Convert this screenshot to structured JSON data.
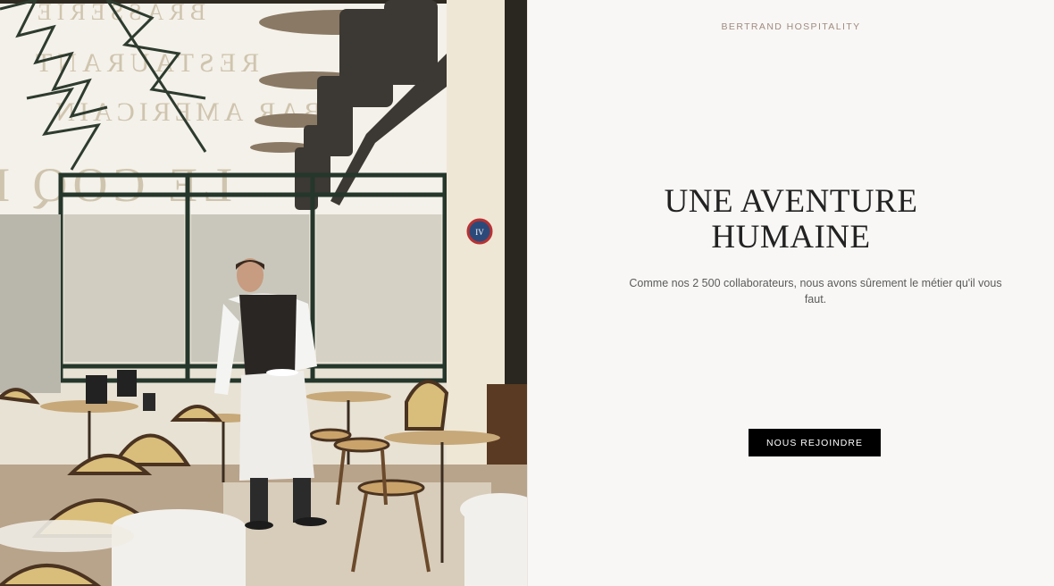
{
  "brand": {
    "name": "BERTRAND HOSPITALITY"
  },
  "hero": {
    "headline_line1": "UNE AVENTURE",
    "headline_line2": "HUMAINE",
    "subtitle": "Comme nos 2 500 collaborateurs, nous avons sûrement le métier qu'il vous faut.",
    "cta_label": "NOUS REJOINDRE"
  },
  "photo": {
    "awning_text_lines": [
      "BRASSERIE",
      "RESTAURANT",
      "BAR AMERICAIN",
      "LE COQ D'OR"
    ],
    "sign_text": "IV"
  },
  "colors": {
    "background": "#f8f7f5",
    "brand_text": "#a08a80",
    "headline": "#222222",
    "subtitle": "#5b5b5b",
    "button_bg": "#000000",
    "button_text": "#ffffff"
  }
}
